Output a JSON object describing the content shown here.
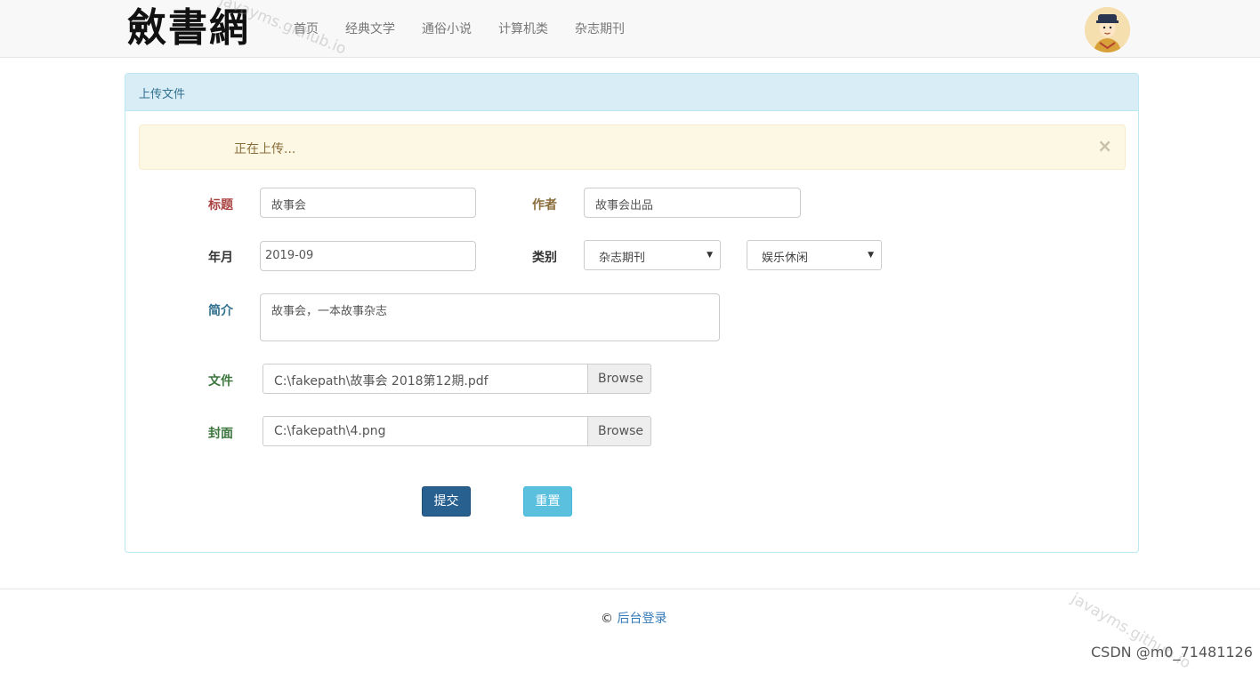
{
  "nav": {
    "brand": "斂書網",
    "items": [
      "首页",
      "经典文学",
      "通俗小说",
      "计算机类",
      "杂志期刊"
    ]
  },
  "watermarks": [
    "javayms.github.io",
    "javayms.github.io",
    "javayms.github.io"
  ],
  "panel": {
    "heading": "上传文件"
  },
  "alert": {
    "text": "正在上传...",
    "close": "×"
  },
  "form": {
    "title_label": "标题",
    "title_value": "故事会",
    "author_label": "作者",
    "author_value": "故事会出品",
    "date_label": "年月",
    "date_value": "2019-09",
    "category_label": "类别",
    "category_value": "杂志期刊",
    "subcategory_value": "娱乐休闲",
    "intro_label": "简介",
    "intro_value": "故事会，一本故事杂志",
    "file_label": "文件",
    "file_value": "C:\\fakepath\\故事会 2018第12期.pdf",
    "cover_label": "封面",
    "cover_value": "C:\\fakepath\\4.png",
    "browse_label": "Browse",
    "submit_label": "提交",
    "reset_label": "重置"
  },
  "footer": {
    "copyright": "© ",
    "link": "后台登录"
  },
  "csdn": "CSDN @m0_71481126",
  "colors": {
    "label_red": "#a94442",
    "label_gold": "#8a6d3b",
    "label_dark": "#333333",
    "label_blue": "#31708f",
    "label_green": "#3c763d",
    "submit_bg": "#286090",
    "reset_bg": "#5bc0de"
  }
}
